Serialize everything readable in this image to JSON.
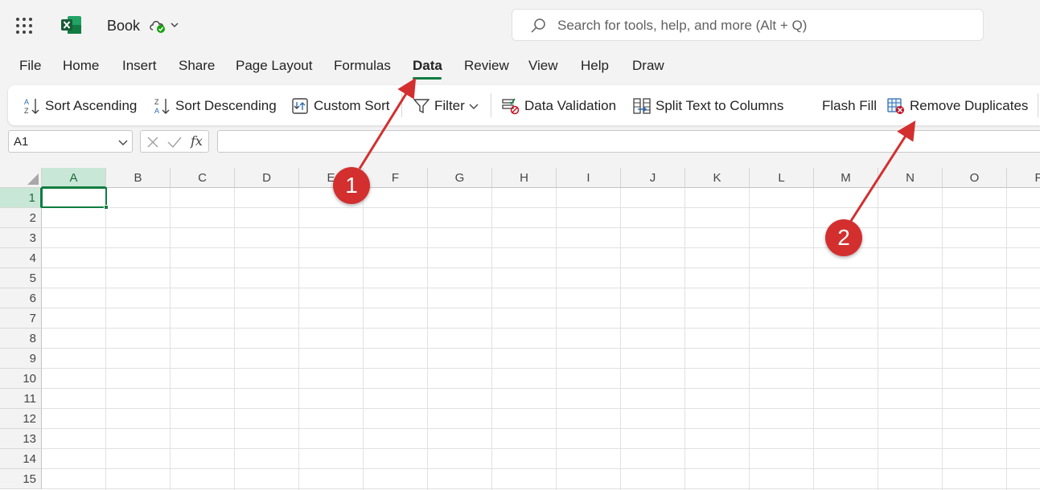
{
  "titlebar": {
    "app_name": "Book",
    "search_placeholder": "Search for tools, help, and more (Alt + Q)"
  },
  "menu": {
    "tabs": [
      "File",
      "Home",
      "Insert",
      "Share",
      "Page Layout",
      "Formulas",
      "Data",
      "Review",
      "View",
      "Help",
      "Draw"
    ],
    "active_tab": "Data"
  },
  "ribbon": {
    "sort_ascending": "Sort Ascending",
    "sort_descending": "Sort Descending",
    "custom_sort": "Custom Sort",
    "filter": "Filter",
    "data_validation": "Data Validation",
    "split_text": "Split Text to Columns",
    "flash_fill": "Flash Fill",
    "remove_duplicates": "Remove Duplicates"
  },
  "formula_bar": {
    "name_box": "A1",
    "fx_label": "fx",
    "formula": ""
  },
  "grid": {
    "columns": [
      "A",
      "B",
      "C",
      "D",
      "E",
      "F",
      "G",
      "H",
      "I",
      "J",
      "K",
      "L",
      "M",
      "N",
      "O",
      "P"
    ],
    "rows": [
      "1",
      "2",
      "3",
      "4",
      "5",
      "6",
      "7",
      "8",
      "9",
      "10",
      "11",
      "12",
      "13",
      "14",
      "15"
    ],
    "selected_cell": "A1"
  },
  "annotations": {
    "step1": "1",
    "step2": "2"
  },
  "colors": {
    "excel_green": "#107c41",
    "annotation_red": "#d32f2f"
  }
}
